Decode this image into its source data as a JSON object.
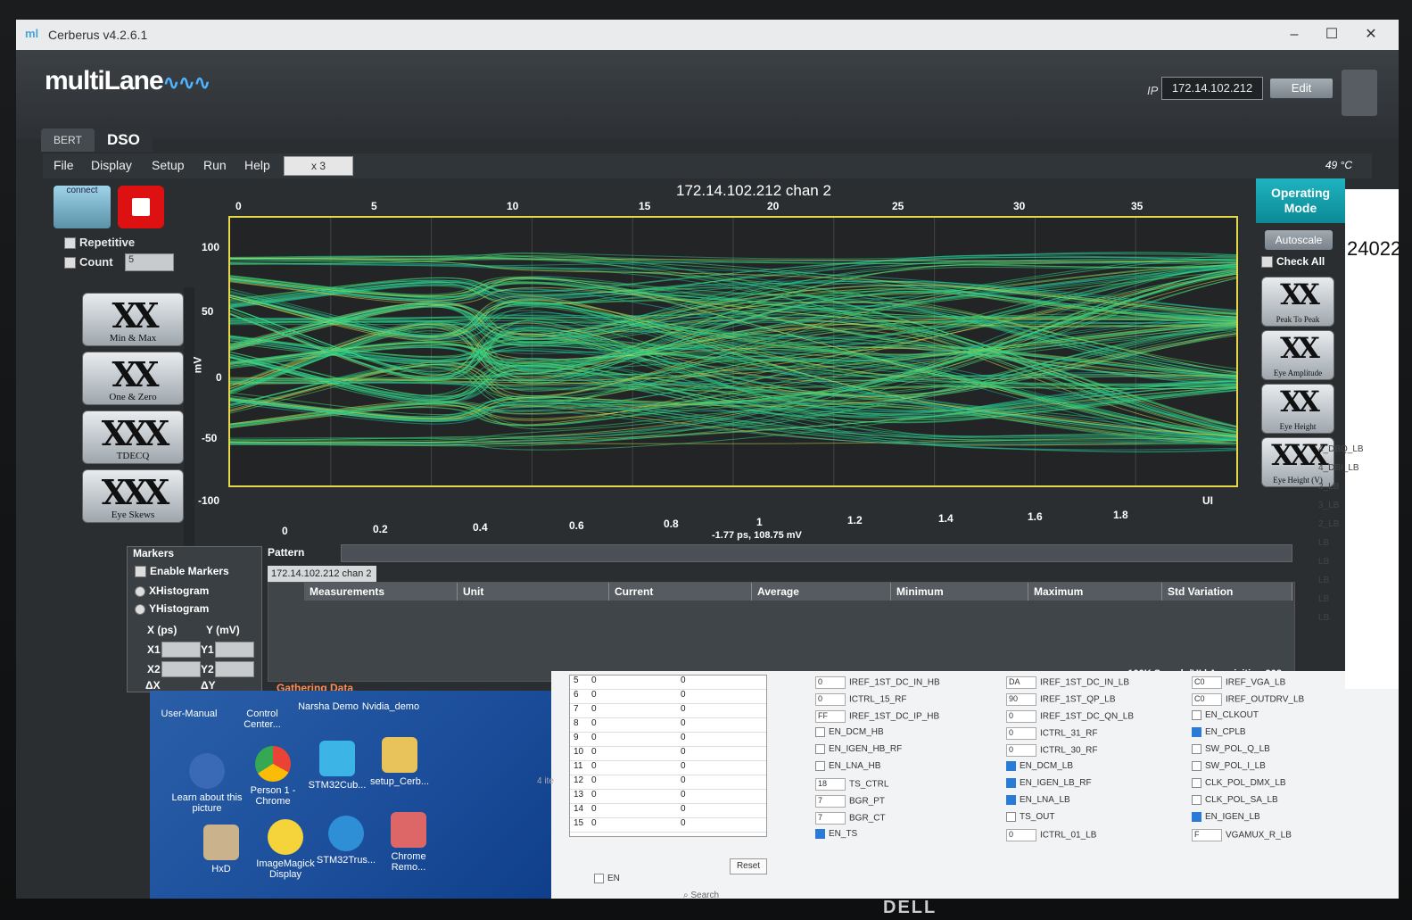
{
  "window": {
    "title": "Cerberus v4.2.6.1",
    "minimize": "–",
    "maximize": "☐",
    "close": "✕"
  },
  "header": {
    "brand": "multiLane",
    "ip_label": "IP",
    "ip_value": "172.14.102.212",
    "edit_label": "Edit"
  },
  "tabs": [
    {
      "label": "BERT"
    },
    {
      "label": "DSO"
    }
  ],
  "menu": {
    "file": "File",
    "display": "Display",
    "setup": "Setup",
    "run": "Run",
    "help": "Help",
    "zoom": "x 3",
    "temperature": "49 °C"
  },
  "left": {
    "connect": "connect",
    "repetitive": "Repetitive",
    "count_label": "Count",
    "count_value": "5",
    "eye_buttons": [
      {
        "glyph": "XX",
        "label": "Min & Max"
      },
      {
        "glyph": "XX",
        "label": "One & Zero"
      },
      {
        "glyph": "XXX",
        "label": "TDECQ"
      },
      {
        "glyph": "XXX",
        "label": "Eye Skews"
      }
    ]
  },
  "chart": {
    "title": "172.14.102.212 chan 2",
    "top_ticks": [
      "0",
      "5",
      "10",
      "15",
      "20",
      "25",
      "30",
      "35"
    ],
    "y_ticks": [
      "100",
      "50",
      "0",
      "-50",
      "-100"
    ],
    "y_unit": "mV",
    "bottom_ticks": [
      "0",
      "0.2",
      "0.4",
      "0.6",
      "0.8",
      "1",
      "1.2",
      "1.4",
      "1.6",
      "1.8"
    ],
    "bottom_unit": "UI",
    "readout": "-1.77 ps, 108.75 mV"
  },
  "chart_data": {
    "type": "eye-diagram",
    "title": "172.14.102.212 chan 2",
    "ylabel": "mV",
    "xlabel": "UI",
    "ylim": [
      -100,
      100
    ],
    "xlim": [
      0,
      2
    ],
    "top_axis": [
      0,
      38
    ],
    "eye_levels_mV": [
      75,
      25,
      -25,
      -75
    ]
  },
  "right": {
    "operating_mode": "Operating Mode",
    "autoscale": "Autoscale",
    "check_all": "Check All",
    "eye_buttons": [
      {
        "glyph": "XX",
        "label": "Peak To Peak"
      },
      {
        "glyph": "XX",
        "label": "Eye Amplitude"
      },
      {
        "glyph": "XX",
        "label": "Eye Height"
      },
      {
        "glyph": "XXX",
        "label": "Eye Height (V)"
      }
    ]
  },
  "markers": {
    "title": "Markers",
    "enable": "Enable Markers",
    "x_hist": "XHistogram",
    "y_hist": "YHistogram",
    "x_col": "X (ps)",
    "y_col": "Y (mV)",
    "rows": [
      "X1",
      "Y1",
      "X2",
      "Y2",
      "ΔX",
      "ΔY"
    ]
  },
  "measurements": {
    "pattern_label": "Pattern",
    "chan_tab": "172.14.102.212 chan 2",
    "columns": [
      "Measurements",
      "Unit",
      "Current",
      "Average",
      "Minimum",
      "Maximum",
      "Std Variation"
    ],
    "sample_rate": "100K Sample/UI",
    "acquisition": "Acquisition 908",
    "status": "Gathering Data"
  },
  "desktop": {
    "icons": [
      {
        "label": "User-Manual"
      },
      {
        "label": "Control Center..."
      },
      {
        "label": "Narsha Demo"
      },
      {
        "label": "Nvidia_demo"
      },
      {
        "label": "Learn about this picture"
      },
      {
        "label": "Person 1 - Chrome"
      },
      {
        "label": "STM32Cub..."
      },
      {
        "label": "setup_Cerb..."
      },
      {
        "label": "HxD"
      },
      {
        "label": "ImageMagick Display"
      },
      {
        "label": "STM32Trus..."
      },
      {
        "label": "Chrome Remo..."
      }
    ]
  },
  "registers": {
    "table_rows": [
      {
        "idx": "5",
        "a": "0",
        "b": "0"
      },
      {
        "idx": "6",
        "a": "0",
        "b": "0"
      },
      {
        "idx": "7",
        "a": "0",
        "b": "0"
      },
      {
        "idx": "8",
        "a": "0",
        "b": "0"
      },
      {
        "idx": "9",
        "a": "0",
        "b": "0"
      },
      {
        "idx": "10",
        "a": "0",
        "b": "0"
      },
      {
        "idx": "11",
        "a": "0",
        "b": "0"
      },
      {
        "idx": "12",
        "a": "0",
        "b": "0"
      },
      {
        "idx": "13",
        "a": "0",
        "b": "0"
      },
      {
        "idx": "14",
        "a": "0",
        "b": "0"
      },
      {
        "idx": "15",
        "a": "0",
        "b": "0"
      }
    ],
    "col1": [
      {
        "val": "0",
        "name": "IREF_1ST_DC_IN_HB"
      },
      {
        "val": "0",
        "name": "ICTRL_15_RF"
      },
      {
        "val": "FF",
        "name": "IREF_1ST_DC_IP_HB"
      },
      {
        "check": false,
        "name": "EN_DCM_HB"
      },
      {
        "check": false,
        "name": "EN_IGEN_HB_RF"
      },
      {
        "check": false,
        "name": "EN_LNA_HB"
      },
      {
        "val": "18",
        "name": "TS_CTRL"
      },
      {
        "val": "7",
        "name": "BGR_PT"
      },
      {
        "val": "7",
        "name": "BGR_CT"
      },
      {
        "check": true,
        "name": "EN_TS"
      }
    ],
    "col2": [
      {
        "val": "DA",
        "name": "IREF_1ST_DC_IN_LB"
      },
      {
        "val": "90",
        "name": "IREF_1ST_QP_LB"
      },
      {
        "val": "0",
        "name": "IREF_1ST_DC_QN_LB"
      },
      {
        "val": "0",
        "name": "ICTRL_31_RF"
      },
      {
        "val": "0",
        "name": "ICTRL_30_RF"
      },
      {
        "check": true,
        "name": "EN_DCM_LB"
      },
      {
        "check": true,
        "name": "EN_IGEN_LB_RF"
      },
      {
        "check": true,
        "name": "EN_LNA_LB"
      },
      {
        "check": false,
        "name": "TS_OUT"
      },
      {
        "val": "0",
        "name": "ICTRL_01_LB"
      }
    ],
    "col3": [
      {
        "val": "C0",
        "name": "IREF_VGA_LB"
      },
      {
        "val": "C0",
        "name": "IREF_OUTDRV_LB"
      },
      {
        "check": false,
        "name": "EN_CLKOUT"
      },
      {
        "check": true,
        "name": "EN_CPLB"
      },
      {
        "check": false,
        "name": "SW_POL_Q_LB"
      },
      {
        "check": false,
        "name": "SW_POL_I_LB"
      },
      {
        "check": false,
        "name": "CLK_POL_DMX_LB"
      },
      {
        "check": false,
        "name": "CLK_POL_SA_LB"
      },
      {
        "check": true,
        "name": "EN_IGEN_LB"
      },
      {
        "val": "F",
        "name": "VGAMUX_R_LB"
      }
    ],
    "reset": "Reset",
    "en": "EN",
    "search": "Search",
    "items_count": "4 ite"
  },
  "sidewin": {
    "big_text": "24022",
    "items": [
      "4_DBQ_LB",
      "4_DBI_LB",
      "2_LB",
      "3_LB",
      "2_LB",
      "LB",
      "LB",
      "LB",
      "LB",
      "LB"
    ]
  },
  "monitor_brand": "DELL"
}
